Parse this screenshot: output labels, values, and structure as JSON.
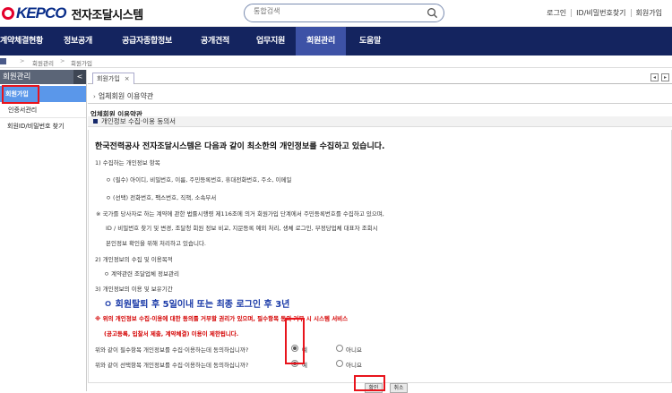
{
  "header": {
    "logo_text": "KEPCO",
    "site_title": "전자조달시스템",
    "search_placeholder": "통합검색",
    "links": [
      "로그인",
      "ID/비밀번호찾기",
      "회원가입"
    ]
  },
  "gnb": {
    "items": [
      "계약체결현황",
      "정보공개",
      "공급자종합정보",
      "공개견적",
      "업무지원",
      "회원관리",
      "도움말"
    ],
    "active": "회원관리"
  },
  "breadcrumb": [
    "회원관리",
    "회원가입"
  ],
  "sidebar": {
    "title": "회원관리",
    "collapse_glyph": "<",
    "items": [
      "회원가입",
      "인증서관리",
      "회원ID/비밀번호 찾기"
    ]
  },
  "tabs": {
    "open": [
      {
        "label": "회원가입",
        "close": "×"
      }
    ]
  },
  "content": {
    "section_title": "업체회원 이용약관",
    "heading": "업체회원 이용약관",
    "sub_heading": "개인정보 수집·이용 동의서",
    "terms": {
      "headline": "한국전력공사 전자조달시스템은 다음과 같이 최소한의 개인정보를 수집하고 있습니다.",
      "lines": [
        "1) 수집하는 개인정보 항목",
        "ㅇ (필수) 아이디, 비밀번호, 이름, 주민등록번호, 휴대전화번호, 주소, 이메일",
        "ㅇ (선택) 전화번호, 팩스번호, 직책, 소속부서",
        "※ 국가를 당사자로 하는 계약에 관한 법률시행령 제116조에 의거 회원가입 단계에서 주민등록번호를 수집하고 있으며,",
        "ID / 비밀번호 찾기 및 변경, 조달청 회원 정보 비교, 지문등록 예외 처리, 생체 로그인, 부정당업체 대표자 조회시",
        "본인정보 확인을 위해 처리하고 있습니다.",
        "2) 개인정보의 수집 및 이용목적",
        "ㅇ 계약관련 조달업체 정보관리",
        "3) 개인정보의 이용 및 보유기간"
      ],
      "retention": "ㅇ 회원탈퇴 후 5일이내 또는 최종 로그인 후 3년",
      "warning1": "※ 위의 개인정보 수집·이용에 대한 동의를 거부할 권리가 있으며, 필수항목 동의 거부 시 시스템 서비스",
      "warning2": "(공고등록, 입찰서 제출, 계약체결) 이용이 제한됩니다."
    },
    "consents": [
      {
        "question": "위와 같이 필수항목 개인정보를 수집·이용하는데 동의하십니까?",
        "yes": "예",
        "no": "아니요",
        "selected": "yes"
      },
      {
        "question": "위와 같이 선택항목 개인정보를 수집·이용하는데 동의하십니까?",
        "yes": "예",
        "no": "아니요",
        "selected": "yes"
      }
    ],
    "buttons": {
      "confirm": "확인",
      "cancel": "취소"
    }
  },
  "colors": {
    "gnb_bg": "#14245f",
    "gnb_active": "#3d52a6",
    "sidebar_selected": "#5a97ea",
    "highlight_box": "#e8141c",
    "retention_text": "#1a3aa8",
    "warning_text": "#d40000"
  },
  "icons": {
    "search": "magnifier-icon",
    "home": "home-icon",
    "tab_close": "close-icon"
  }
}
